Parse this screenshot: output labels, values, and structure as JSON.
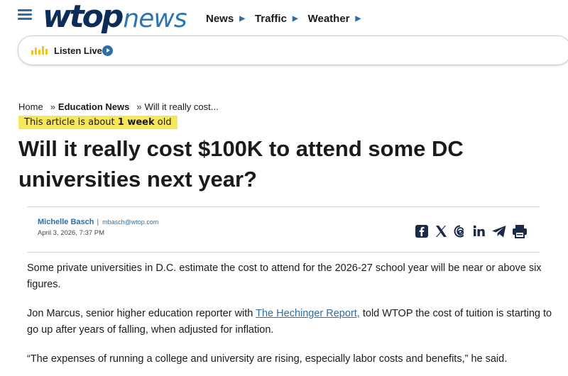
{
  "header": {
    "logo_primary": "wtop",
    "logo_secondary": "news",
    "nav": [
      {
        "label": "News"
      },
      {
        "label": "Traffic"
      },
      {
        "label": "Weather"
      }
    ]
  },
  "listen": {
    "label": "Listen Live"
  },
  "breadcrumb": {
    "home": "Home",
    "sep": "»",
    "section": "Education News",
    "current": "Will it really cost..."
  },
  "age_notice": {
    "prefix": "This article is about",
    "age": "1 week",
    "suffix": "old"
  },
  "article": {
    "title": "Will it really cost $100K to attend some DC universities next year?",
    "author": "Michelle Basch",
    "email": "mbasch@wtop.com",
    "date": "April 3, 2026, 7:37 PM",
    "paragraphs": {
      "p1": "Some private universities in D.C. estimate the cost to attend for the 2026-27 school year will be near or above six figures.",
      "p2_before": "Jon Marcus, senior higher education reporter with",
      "p2_link": "The Hechinger Report,",
      "p2_after": "told WTOP the cost of tuition is starting to go up after years of falling, when adjusted for inflation.",
      "p3": "“The expenses of running a college and university are rising, especially labor costs and benefits,” he said."
    }
  },
  "share_icons": [
    "facebook-icon",
    "x-icon",
    "threads-icon",
    "linkedin-icon",
    "telegram-icon",
    "print-icon"
  ],
  "colors": {
    "brand_dark": "#0c2d57",
    "brand_blue": "#2c6ea5",
    "highlight": "#f5e65b"
  }
}
